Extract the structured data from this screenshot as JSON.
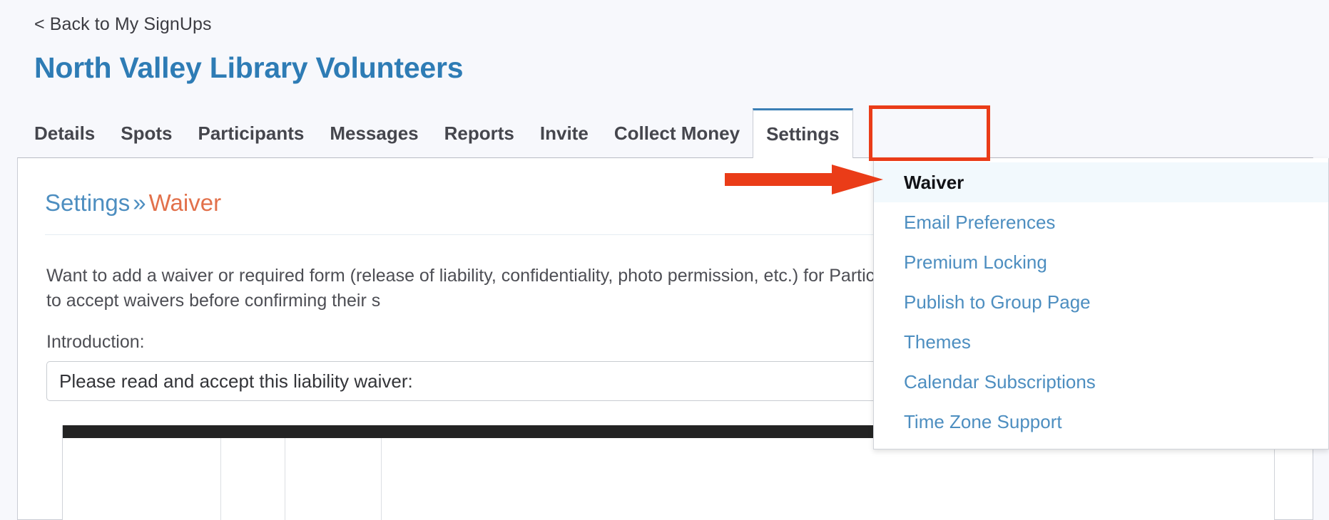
{
  "header": {
    "back_link": "< Back to My SignUps",
    "title": "North Valley Library Volunteers"
  },
  "tabs": [
    {
      "label": "Details",
      "active": false
    },
    {
      "label": "Spots",
      "active": false
    },
    {
      "label": "Participants",
      "active": false
    },
    {
      "label": "Messages",
      "active": false
    },
    {
      "label": "Reports",
      "active": false
    },
    {
      "label": "Invite",
      "active": false
    },
    {
      "label": "Collect Money",
      "active": false
    },
    {
      "label": "Settings",
      "active": true
    }
  ],
  "dropdown": {
    "items": [
      {
        "label": "Waiver",
        "selected": true
      },
      {
        "label": "Email Preferences",
        "selected": false
      },
      {
        "label": "Premium Locking",
        "selected": false
      },
      {
        "label": "Publish to Group Page",
        "selected": false
      },
      {
        "label": "Themes",
        "selected": false
      },
      {
        "label": "Calendar Subscriptions",
        "selected": false
      },
      {
        "label": "Time Zone Support",
        "selected": false
      }
    ]
  },
  "breadcrumb": {
    "parent": "Settings",
    "separator": "»",
    "current": "Waiver"
  },
  "main": {
    "body_text": "Want to add a waiver or required form (release of liability, confidentiality, photo permission, etc.) for Participants when they sign up. Participants are required to accept waivers before confirming their s",
    "intro_label": "Introduction:",
    "intro_value": "Please read and accept this liability waiver:",
    "intro_placeholder": "Please read and accept this liability waiver:"
  },
  "colors": {
    "page_background": "#f7f8fc",
    "title_blue": "#2e7cb5",
    "link_blue": "#4d8ec0",
    "breadcrumb_orange": "#e2714b",
    "annotation_red": "#ea3c18",
    "active_tab_border": "#3b7fb5",
    "selected_menu_background": "#f2f9fd",
    "editor_bar": "#232323"
  }
}
